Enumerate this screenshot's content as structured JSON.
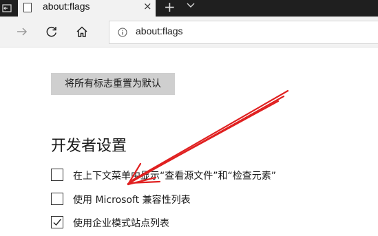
{
  "browser": {
    "tab_title": "about:flags",
    "address": "about:flags",
    "colors": {
      "tabstrip": "#1f1f1f",
      "toolbar": "#f2f2f2"
    },
    "icons": {
      "back_in_tabstrip": "tab-set-aside-icon",
      "page": "page-icon",
      "close": "close-icon",
      "new_tab": "plus-icon",
      "tab_list": "chevron-down-icon",
      "forward": "forward-arrow-icon",
      "refresh": "refresh-icon",
      "home": "home-icon",
      "site_info": "info-icon"
    },
    "close_glyph": "×",
    "new_tab_glyph": "+"
  },
  "page": {
    "reset_button_label": "将所有标志重置为默认",
    "section_heading": "开发者设置",
    "options": [
      {
        "label": "在上下文菜单中显示“查看源文件”和“检查元素”",
        "checked": false
      },
      {
        "label": "使用 Microsoft 兼容性列表",
        "checked": false
      },
      {
        "label": "使用企业模式站点列表",
        "checked": true
      }
    ]
  },
  "annotation": {
    "arrow_color": "#e02020"
  }
}
